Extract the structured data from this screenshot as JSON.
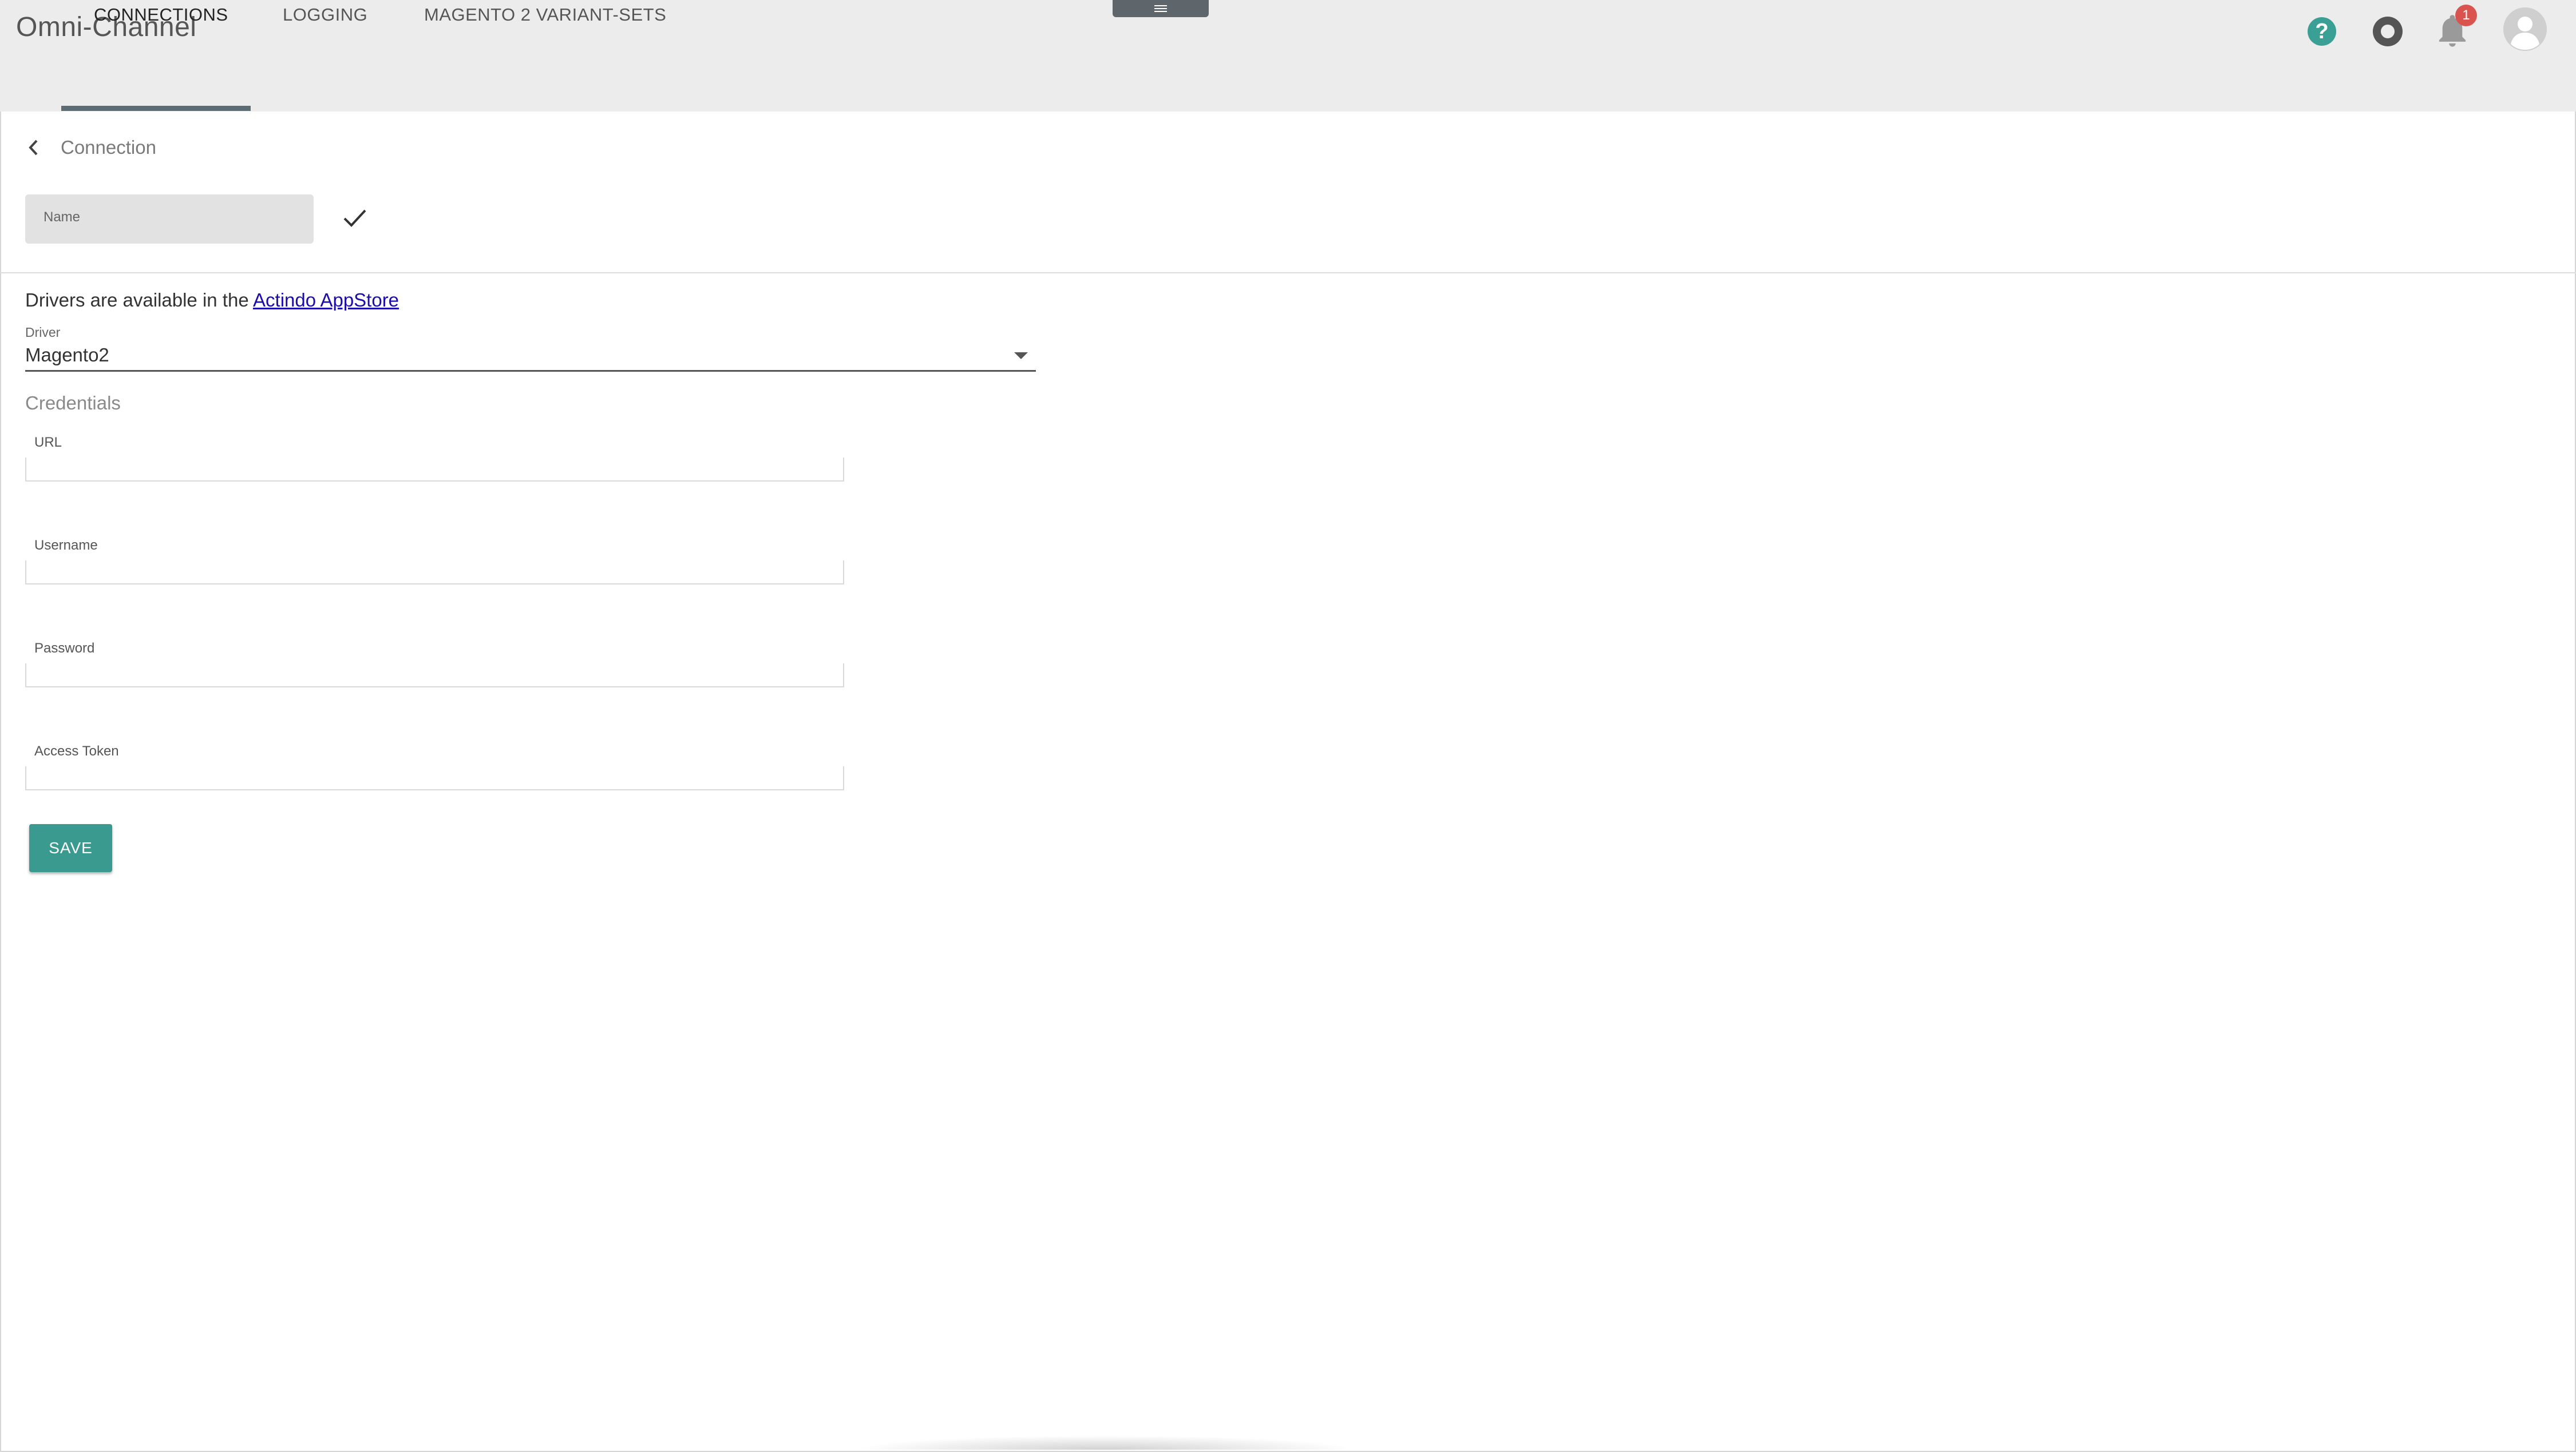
{
  "app": {
    "title": "Omni-Channel"
  },
  "header": {
    "notification_count": "1"
  },
  "tabs": [
    {
      "label": "CONNECTIONS",
      "active": true
    },
    {
      "label": "LOGGING",
      "active": false
    },
    {
      "label": "MAGENTO 2 VARIANT-SETS",
      "active": false
    }
  ],
  "breadcrumb": {
    "label": "Connection"
  },
  "form": {
    "name_placeholder": "Name",
    "drivers_note_prefix": "Drivers are available in the ",
    "drivers_link": "Actindo AppStore",
    "driver_label": "Driver",
    "driver_value": "Magento2",
    "credentials_title": "Credentials",
    "credentials": [
      {
        "label": "URL",
        "value": ""
      },
      {
        "label": "Username",
        "value": ""
      },
      {
        "label": "Password",
        "value": ""
      },
      {
        "label": "Access Token",
        "value": ""
      }
    ],
    "save_label": "SAVE"
  },
  "colors": {
    "accent": "#3a9a90",
    "header_bg": "#ececec",
    "badge": "#d9534f",
    "link": "#1a0dab"
  },
  "icons": [
    "help-icon",
    "status-icon",
    "bell-icon",
    "avatar-icon",
    "back-icon",
    "check-icon",
    "menu-handle-icon",
    "chevron-down-icon"
  ]
}
